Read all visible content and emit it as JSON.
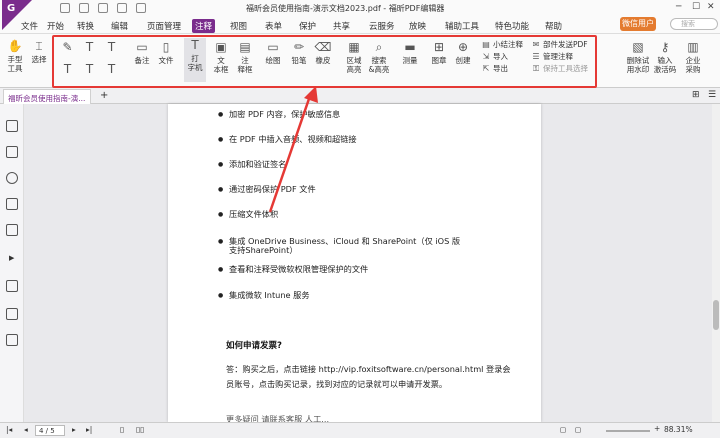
{
  "window": {
    "title": "福昕会员使用指南-演示文档2023.pdf - 福昕PDF编辑器",
    "logo": "G"
  },
  "menu": {
    "items": [
      "文件",
      "开始",
      "转换",
      "编辑",
      "页面管理",
      "注释",
      "视图",
      "表单",
      "保护",
      "共享",
      "云服务",
      "放映",
      "辅助工具",
      "特色功能",
      "帮助"
    ],
    "vip": "微信用户",
    "search_placeholder": "搜索"
  },
  "ribbon": {
    "hand": "手型\n工具",
    "select": "选择",
    "note": "备注",
    "file": "文件",
    "typewriter": "打\n字机",
    "textbox": "文\n本框",
    "callout": "注\n释框",
    "draw": "绘图",
    "pencil": "铅笔",
    "eraser": "橡皮",
    "area_highlight": "区域\n高亮",
    "search_highlight": "搜索\n&高亮",
    "measure": "测量",
    "stamp": "图章",
    "create": "创建",
    "summary": "小结注释",
    "import": "导入",
    "export": "导出",
    "send_pdf": "部件发送PDF",
    "manage": "管理注释",
    "keep_tool": "保持工具选择",
    "watermark": "删除试\n用水印",
    "activation": "输入\n激活码",
    "purchase": "企业\n采购"
  },
  "tab": {
    "label": "福昕会员使用指南-演..."
  },
  "document": {
    "bullets": [
      "加密 PDF 内容，保护敏感信息",
      "在 PDF 中插入音频、视频和超链接",
      "添加和验证签名",
      "通过密码保护 PDF 文件",
      "压缩文件体积",
      "集成 OneDrive Business、iCloud 和 SharePoint（仅 iOS 版",
      "支持SharePoint）",
      "查看和注释受微软权限管理保护的文件",
      "集成微软 Intune 服务"
    ],
    "heading": "如何申请发票?",
    "para1": "答：购买之后，点击链接 http://vip.foxitsoftware.cn/personal.html 登录会",
    "para2": "员账号，点击购买记录，找到对应的记录就可以申请开发票。",
    "para3": "更多疑问 请联系客服 人工..."
  },
  "status": {
    "page": "4 / 5",
    "zoom": "88.31%"
  },
  "colors": {
    "brand": "#7a2c8c",
    "highlight_box": "#e53935",
    "arrow": "#e53935"
  }
}
